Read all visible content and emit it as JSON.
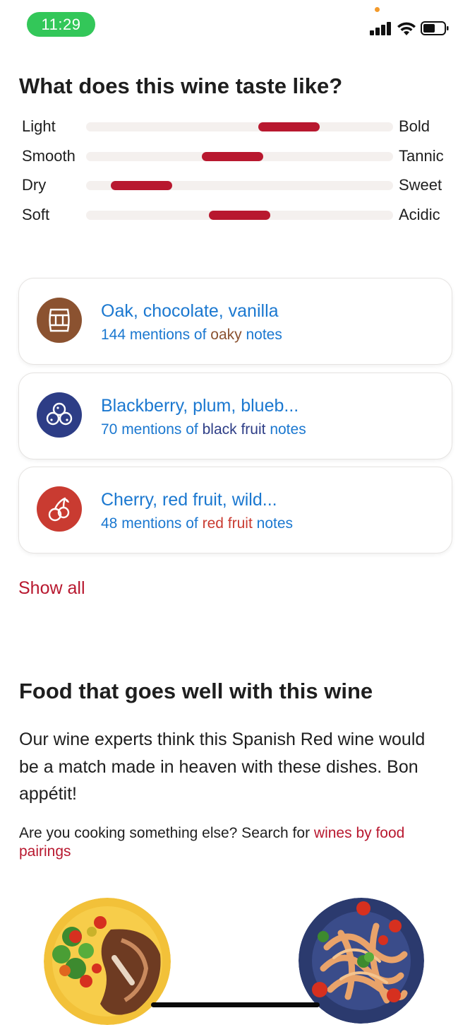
{
  "status_bar": {
    "time": "11:29"
  },
  "taste": {
    "title": "What does this wine taste like?",
    "rows": [
      {
        "left": "Light",
        "right": "Bold",
        "value": 0.7
      },
      {
        "left": "Smooth",
        "right": "Tannic",
        "value": 0.47
      },
      {
        "left": "Dry",
        "right": "Sweet",
        "value": 0.1
      },
      {
        "left": "Soft",
        "right": "Acidic",
        "value": 0.5
      }
    ]
  },
  "flavors": [
    {
      "icon": "barrel-icon",
      "icon_color": "#8b5230",
      "title": "Oak, chocolate, vanilla",
      "count_text": "144 mentions of",
      "category": "oaky",
      "category_color": "#8b5230",
      "suffix": "notes"
    },
    {
      "icon": "berries-icon",
      "icon_color": "#2d3d86",
      "title": "Blackberry, plum, blueb...",
      "count_text": "70 mentions of",
      "category": "black fruit",
      "category_color": "#2d3d86",
      "suffix": "notes"
    },
    {
      "icon": "cherry-icon",
      "icon_color": "#c93b31",
      "title": "Cherry, red fruit, wild...",
      "count_text": "48 mentions of",
      "category": "red fruit",
      "category_color": "#c93b31",
      "suffix": "notes"
    }
  ],
  "show_all": "Show all",
  "food": {
    "title": "Food that goes well with this wine",
    "description": "Our wine experts think this Spanish Red wine would be a match made in heaven with these dishes. Bon appétit!",
    "search_prefix": "Are you cooking something else? Search for",
    "search_link": "wines by food pairings",
    "dishes": [
      {
        "icon": "steak-plate-image"
      },
      {
        "icon": "pasta-plate-image"
      }
    ]
  },
  "colors": {
    "accent": "#b8182f",
    "link_blue": "#1b78d0",
    "track": "#f4f0ee"
  }
}
